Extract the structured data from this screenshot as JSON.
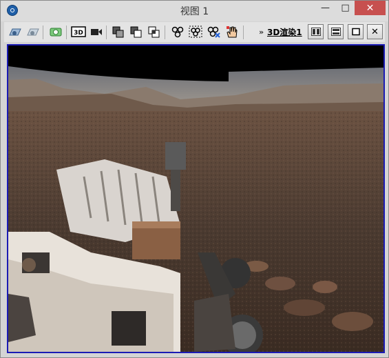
{
  "window": {
    "title": "视图 1",
    "minimize_glyph": "—",
    "maximize_glyph": "□",
    "close_glyph": "✕"
  },
  "toolbar": {
    "more_glyph": "»",
    "render_label": "3D渲染1",
    "buttons": [
      "camera-open-icon",
      "camera-save-icon",
      "screenshot-icon",
      "3d-view-icon",
      "video-record-icon",
      "layer-union-icon",
      "layer-subtract-icon",
      "layer-intersect-icon",
      "node-network-icon",
      "node-select-icon",
      "node-remove-icon",
      "hand-pan-icon"
    ],
    "three_d_text": "3D"
  },
  "layout_buttons": [
    "split-vertical-icon",
    "split-horizontal-icon",
    "single-view-icon",
    "close-view-icon"
  ],
  "close_view_glyph": "✕",
  "viewport": {
    "content": "Mars rover panorama"
  }
}
